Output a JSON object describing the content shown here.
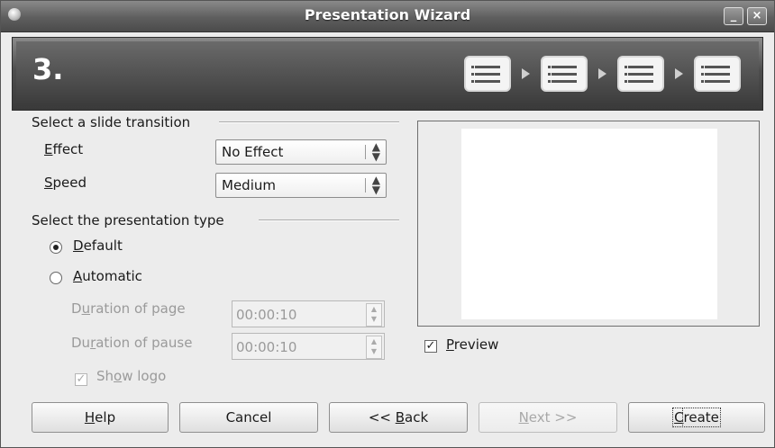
{
  "window": {
    "title": "Presentation Wizard"
  },
  "header": {
    "step_number": "3."
  },
  "transition": {
    "heading": "Select a slide transition",
    "effect_label_mnemonic": "E",
    "effect_label_rest": "ffect",
    "effect_value": "No Effect",
    "speed_label_mnemonic": "S",
    "speed_label_rest": "peed",
    "speed_value": "Medium"
  },
  "presentation_type": {
    "heading": "Select the presentation type",
    "default_mnemonic": "D",
    "default_rest": "efault",
    "automatic_mnemonic": "A",
    "automatic_rest": "utomatic",
    "selected": "Default",
    "duration_page_pre": "D",
    "duration_page_mnemonic": "u",
    "duration_page_rest": "ration of page",
    "duration_page_value": "00:00:10",
    "duration_pause_pre": "Du",
    "duration_pause_mnemonic": "r",
    "duration_pause_rest": "ation of pause",
    "duration_pause_value": "00:00:10",
    "show_logo_pre": "Sh",
    "show_logo_mnemonic": "o",
    "show_logo_rest": "w logo",
    "show_logo_checked": true
  },
  "preview": {
    "label_mnemonic": "P",
    "label_rest": "review",
    "checked": true
  },
  "buttons": {
    "help_mnemonic": "H",
    "help_rest": "elp",
    "cancel": "Cancel",
    "back_pre": "<< ",
    "back_mnemonic": "B",
    "back_rest": "ack",
    "next_mnemonic": "N",
    "next_rest": "ext >>",
    "create_pre": "",
    "create_mnemonic": "C",
    "create_rest": "reate"
  }
}
